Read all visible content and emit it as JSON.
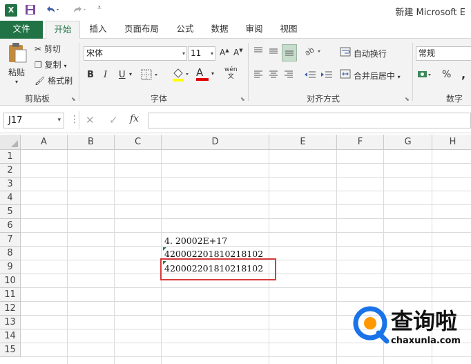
{
  "window": {
    "app_icon": "X",
    "title": "新建 Microsoft E"
  },
  "quick_access": {
    "save": "save-icon",
    "undo": "undo-icon",
    "redo": "redo-icon",
    "customize": "customize-icon"
  },
  "tabs": [
    "文件",
    "开始",
    "插入",
    "页面布局",
    "公式",
    "数据",
    "审阅",
    "视图"
  ],
  "active_tab": "开始",
  "ribbon": {
    "clipboard": {
      "label": "剪贴板",
      "paste": "粘贴",
      "cut": "剪切",
      "copy": "复制",
      "format_painter": "格式刷"
    },
    "font": {
      "label": "字体",
      "font_name": "宋体",
      "font_size": "11",
      "bold": "B",
      "italic": "I",
      "underline": "U",
      "font_color_glyph": "A",
      "phonetic": "wén\n文"
    },
    "alignment": {
      "label": "对齐方式",
      "wrap_text": "自动换行",
      "merge_center": "合并后居中"
    },
    "number": {
      "label": "数字",
      "format": "常规",
      "percent": "%",
      "comma": ","
    }
  },
  "formula_bar": {
    "name_box": "J17",
    "cancel": "✕",
    "enter": "✓",
    "fx": "fx",
    "content": ""
  },
  "columns": [
    "A",
    "B",
    "C",
    "D",
    "E",
    "F",
    "G",
    "H"
  ],
  "rows": [
    "1",
    "2",
    "3",
    "4",
    "5",
    "6",
    "7",
    "8",
    "9",
    "10",
    "11",
    "12",
    "13",
    "14",
    "15"
  ],
  "cells": {
    "D7": "4. 20002E+17",
    "D8": "420002201810218102",
    "D9": "420002201810218102"
  },
  "colors": {
    "brand": "#217346",
    "highlight": "#d83b3b",
    "watermark_blue": "#1a73e8"
  },
  "watermark": {
    "name": "查询啦",
    "domain": "chaxunla.com"
  }
}
